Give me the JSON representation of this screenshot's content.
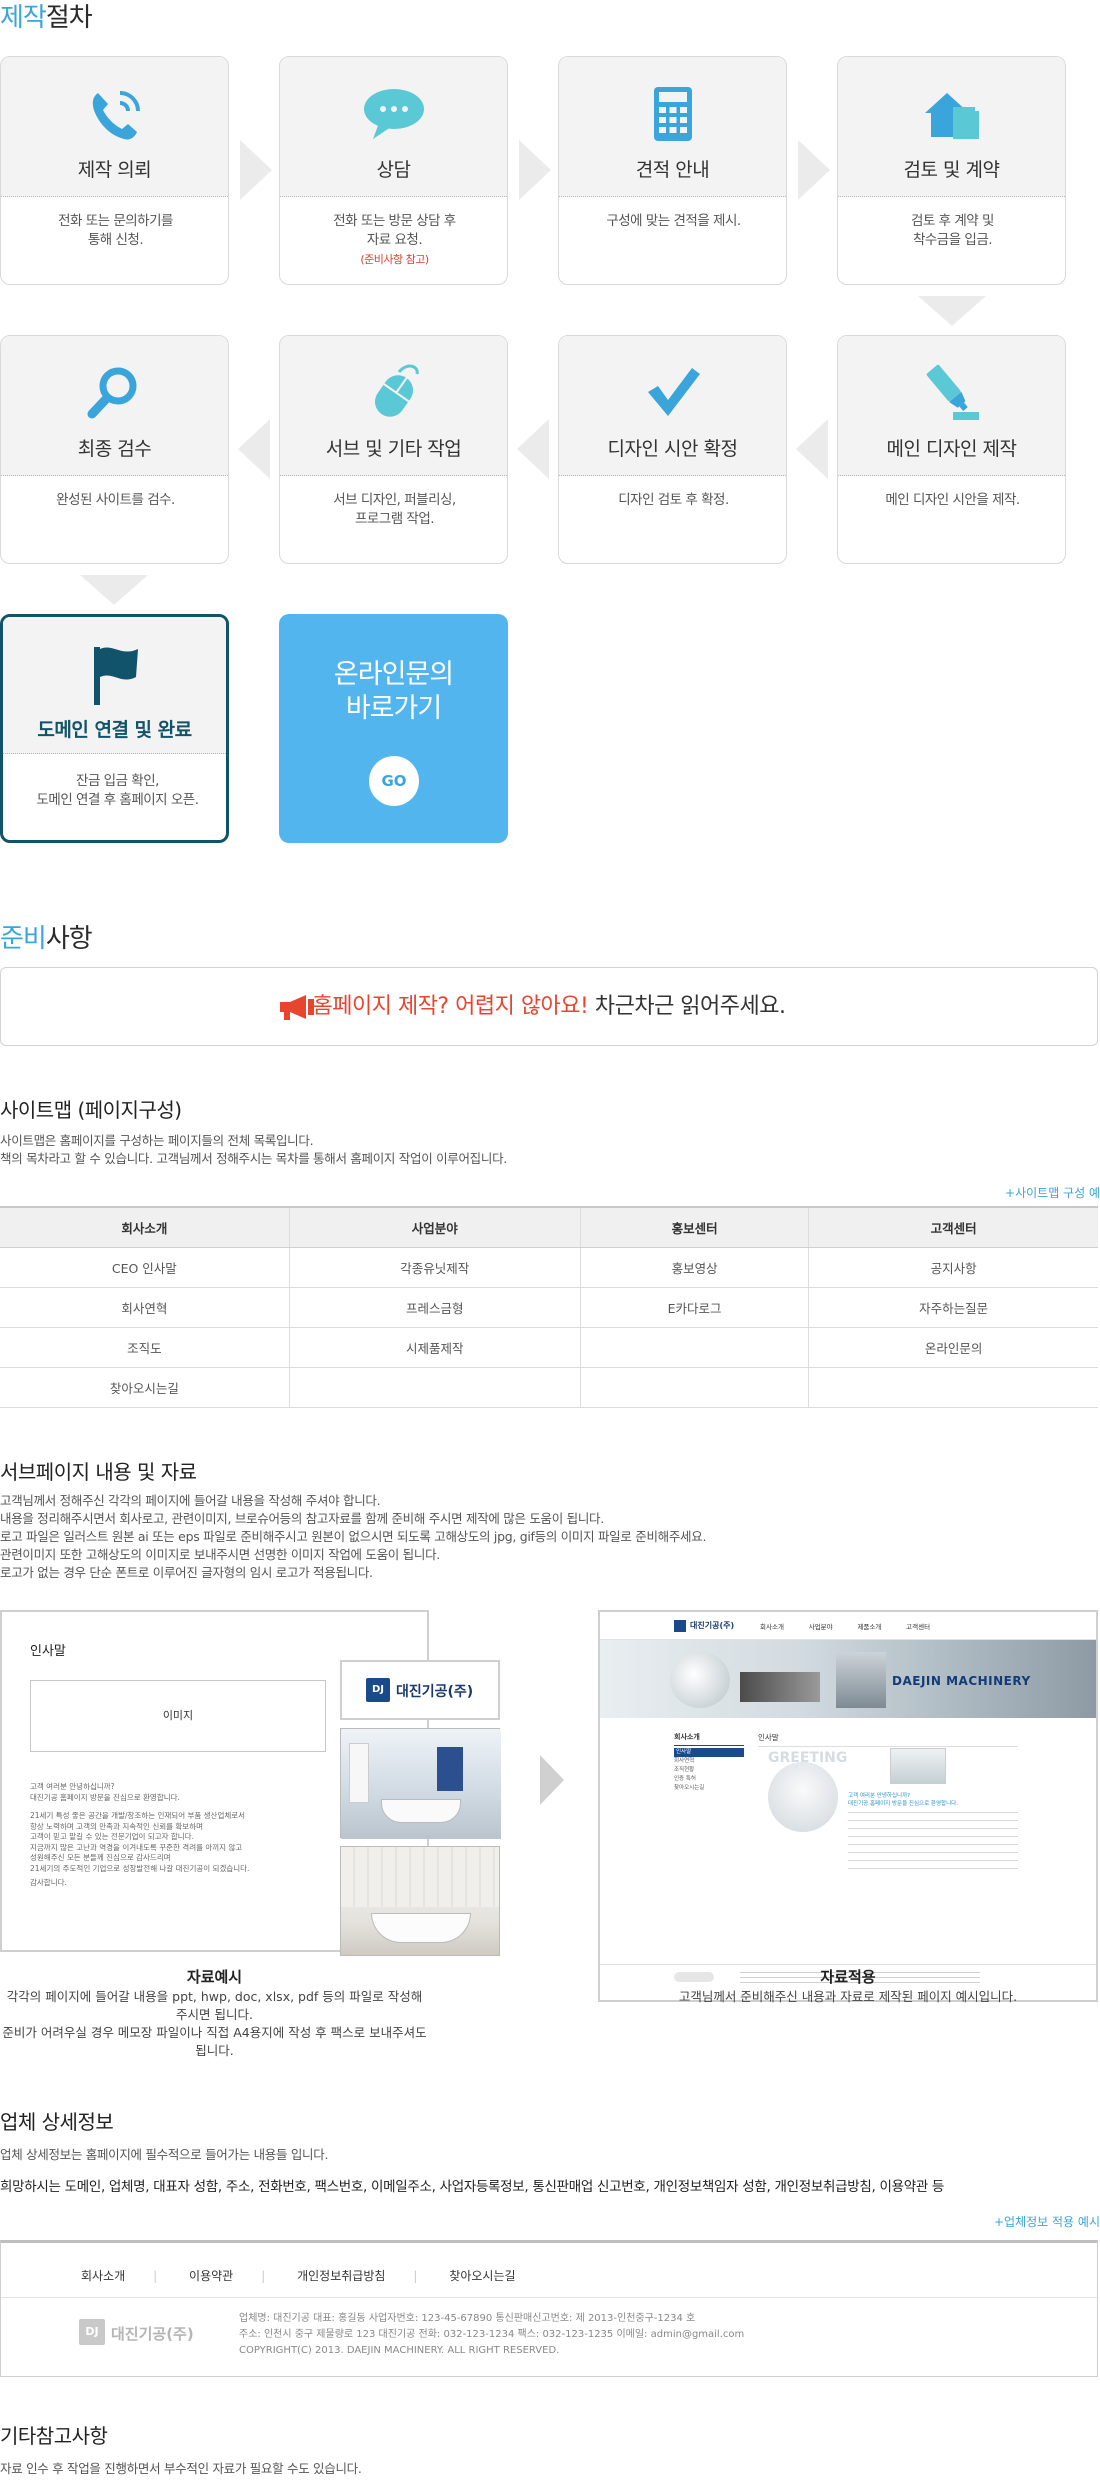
{
  "process": {
    "title_blue": "제작",
    "title_rest": "절차",
    "steps": [
      {
        "title": "제작 의뢰",
        "desc1": "전화 또는 문의하기를",
        "desc2": "통해 신청.",
        "icon": "phone-icon"
      },
      {
        "title": "상담",
        "desc1": "전화 또는 방문 상담 후",
        "desc2": "자료 요청.",
        "note": "(준비사항 참고)",
        "icon": "chat-bubble-icon"
      },
      {
        "title": "견적 안내",
        "desc1": "구성에 맞는 견적을 제시.",
        "icon": "calculator-icon"
      },
      {
        "title": "검토 및 계약",
        "desc1": "검토 후 계약 및",
        "desc2": "착수금을 입금.",
        "icon": "house-document-icon"
      },
      {
        "title": "메인 디자인 제작",
        "desc1": "메인 디자인 시안을 제작.",
        "icon": "highlighter-icon"
      },
      {
        "title": "디자인 시안 확정",
        "desc1": "디자인 검토 후 확정.",
        "icon": "checkmark-icon"
      },
      {
        "title": "서브 및 기타 작업",
        "desc1": "서브 디자인, 퍼블리싱,",
        "desc2": "프로그램 작업.",
        "icon": "mouse-icon"
      },
      {
        "title": "최종 검수",
        "desc1": "완성된 사이트를 검수.",
        "icon": "magnifier-icon"
      },
      {
        "title": "도메인 연결 및 완료",
        "desc1": "잔금 입금 확인,",
        "desc2": "도메인 연결 후 홈페이지 오픈.",
        "icon": "flag-icon"
      }
    ],
    "online": {
      "line1": "온라인문의",
      "line2": "바로가기",
      "go": "GO"
    }
  },
  "prep": {
    "title_blue": "준비",
    "title_rest": "사항",
    "banner_red": "홈페이지 제작? 어렵지 않아요!",
    "banner_rest": " 차근차근 읽어주세요.",
    "banner_icon": "megaphone-icon"
  },
  "sitemap": {
    "title": "사이트맵 (페이지구성)",
    "desc1": "사이트맵은 홈페이지를 구성하는 페이지들의 전체 목록입니다.",
    "desc2": "책의 목차라고 할 수 있습니다. 고객님께서 정해주시는 목차를 통해서 홈페이지 작업이 이루어집니다.",
    "example_link": "+사이트맵 구성 예",
    "headers": [
      "회사소개",
      "사업분야",
      "홍보센터",
      "고객센터"
    ],
    "rows": [
      [
        "CEO 인사말",
        "각종유닛제작",
        "홍보영상",
        "공지사항"
      ],
      [
        "회사연혁",
        "프레스금형",
        "E카다로그",
        "자주하는질문"
      ],
      [
        "조직도",
        "시제품제작",
        "",
        "온라인문의"
      ],
      [
        "찾아오시는길",
        "",
        "",
        ""
      ]
    ]
  },
  "subpage": {
    "title": "서브페이지 내용 및 자료",
    "lines": [
      "고객님께서 정해주신 각각의 페이지에 들어갈 내용을 작성해 주셔야 합니다.",
      "내용을 정리해주시면서 회사로고, 관련이미지, 브로슈어등의 참고자료를 함께 준비해 주시면 제작에 많은 도움이 됩니다.",
      "로고 파일은 일러스트 원본 ai 또는 eps 파일로 준비해주시고 원본이 없으시면 되도록 고해상도의 jpg, gif등의 이미지 파일로 준비해주세요.",
      "관련이미지 또한 고해상도의 이미지로 보내주시면 선명한 이미지 작업에 도움이 됩니다.",
      "로고가 없는 경우 단순 폰트로 이루어진 글자형의 임시 로고가 적용됩니다."
    ],
    "example": {
      "heading": "인사말",
      "image_label": "이미지",
      "logo_text": "대진기공(주)",
      "logo_mark": "DJ",
      "body": [
        "고객 여러분 안녕하십니까?",
        "대진기공 홈페이지 방문을 진심으로 환영합니다.",
        "",
        "21세기 특성 좋은 공간을 개발/창조하는 인재되어 부품 생산업체로서",
        "항상 노력하며 고객의 만족과 지속적인 신뢰를 확보하며",
        "고객이 믿고 맡길 수 있는 전문기업이 되고자 합니다.",
        "지금까지 많은 고난과 역경을 이겨내도록 꾸준한 격려를 아끼지 않고",
        "성원해주신 모든 분들께 진심으로 감사드리며",
        "21세기의 주도적인 기업으로 성장발전해 나갈 대진기공이 되겠습니다.",
        "",
        "감사합니다."
      ],
      "caption_title": "자료예시",
      "caption1": "각각의 페이지에 들어갈 내용을 ppt, hwp, doc, xlsx, pdf 등의 파일로 작성해 주시면 됩니다.",
      "caption2": "준비가 어려우실 경우 메모장 파일이나 직접 A4용지에 작성 후 팩스로 보내주셔도 됩니다."
    },
    "applied": {
      "brand": "대진기공(주)",
      "nav": [
        "회사소개",
        "사업분야",
        "제품소개",
        "고객센터"
      ],
      "hero_title": "DAEJIN MACHINERY",
      "side_title": "회사소개",
      "side_items": [
        "인사말",
        "회사연혁",
        "조직현황",
        "인증 특허",
        "찾아오시는길"
      ],
      "content_title": "인사말",
      "greeting": "GREETING",
      "body_head1": "고객 여러분 안녕하십니까?",
      "body_head2": "대진기공 홈페이지 방문을 진심으로 환영합니다.",
      "caption_title": "자료적용",
      "caption": "고객님께서 준비해주신 내용과 자료로 제작된 페이지 예시입니다."
    }
  },
  "company": {
    "title": "업체 상세정보",
    "desc": "업체 상세정보는 홈페이지에 필수적으로 들어가는 내용들 입니다.",
    "bold": "희망하시는 도메인, 업체명, 대표자 성함, 주소, 전화번호, 팩스번호, 이메일주소, 사업자등록정보, 통신판매업 신고번호, 개인정보책임자 성함, 개인정보취급방침, 이용약관 등",
    "example_link": "+업체정보 적용 예시",
    "footer_nav": [
      "회사소개",
      "이용약관",
      "개인정보취급방침",
      "찾아오시는길"
    ],
    "footer_logo": "대진기공(주)",
    "footer_mark": "DJ",
    "footer_line1": "업체명: 대진기공    대표: 홍길동    사업자번호: 123-45-67890    통신판매신고번호: 제 2013-인천중구-1234 호",
    "footer_line2": "주소: 인천시 중구 제물량로 123 대진기공    전화: 032-123-1234    팩스: 032-123-1235    이메일: admin@gmail.com",
    "footer_line3": "COPYRIGHT(C) 2013. DAEJIN MACHINERY. ALL RIGHT RESERVED."
  },
  "etc": {
    "title": "기타참고사항",
    "desc": "자료 인수 후 작업을 진행하면서 부수적인 자료가 필요할 수도 있습니다."
  },
  "colors": {
    "accent": "#3aa5db",
    "red": "#e8452f",
    "navy": "#10536a",
    "online": "#52b5ee"
  }
}
